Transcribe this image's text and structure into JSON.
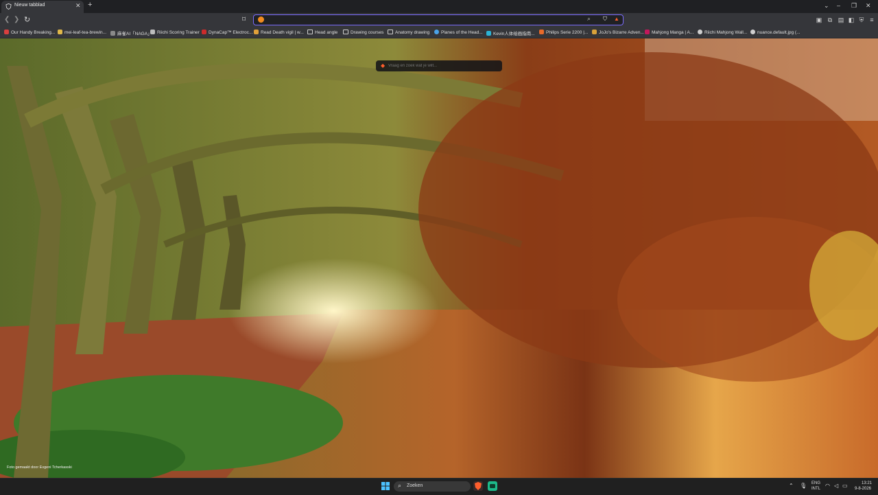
{
  "browser": {
    "tab": {
      "title": "Nieuw tabblad"
    },
    "omnibox": {
      "value": "",
      "placeholder": ""
    },
    "bookmarks": [
      {
        "label": "Our Handy Breaking..."
      },
      {
        "label": "mei-leaf-tea-brewin..."
      },
      {
        "label": "麻雀AI「NAGA」"
      },
      {
        "label": "Riichi Scoring Trainer"
      },
      {
        "label": "DynaCap™ Electroc..."
      },
      {
        "label": "Read Death vigil | w..."
      },
      {
        "label": "Head angle"
      },
      {
        "label": "Drawing courses"
      },
      {
        "label": "Anatomy drawing"
      },
      {
        "label": "Planes of the Head..."
      },
      {
        "label": "Kevin人体绘画指南..."
      },
      {
        "label": "Philips Serie 2200 |..."
      },
      {
        "label": "JoJo's Bizarre Adven..."
      },
      {
        "label": "Mahjong Manga | A..."
      },
      {
        "label": "Riichi Mahjong Wall..."
      },
      {
        "label": "nuance.default.jpg (..."
      }
    ]
  },
  "content": {
    "ai_placeholder": "Vraag en zoek wat je wilt...",
    "photo_credit": "Foto gemaakt door Evgeni Tcherkasski"
  },
  "taskbar": {
    "search_label": "Zoeken",
    "lang": "ENG",
    "layout": "INTL",
    "time": "13:21",
    "date": "9-8-2026"
  },
  "colors": {
    "accent": "#7b6cff",
    "brave": "#ff5e2c"
  }
}
